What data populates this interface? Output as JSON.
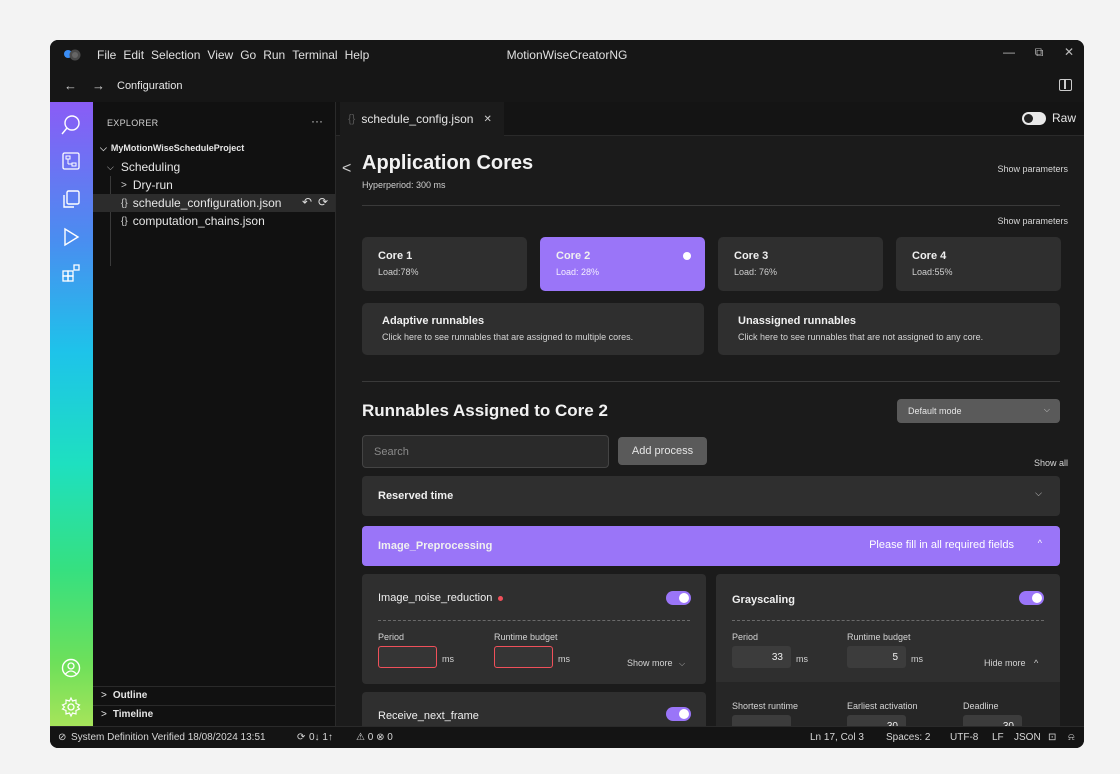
{
  "titlebar": {
    "menu": [
      "File",
      "Edit",
      "Selection",
      "View",
      "Go",
      "Run",
      "Terminal",
      "Help"
    ],
    "title": "MotionWiseCreatorNG",
    "minimize": "—",
    "restore": "⧉",
    "close": "✕"
  },
  "nav": {
    "back": "←",
    "forward": "→",
    "breadcrumb": "Configuration"
  },
  "sidebar": {
    "header": "EXPLORER",
    "more": "···",
    "project": "MyMotionWiseScheduleProject",
    "folder": "Scheduling",
    "subfolder": "Dry-run",
    "files": [
      {
        "icon": "{}",
        "name": "schedule_configuration.json"
      },
      {
        "icon": "{}",
        "name": "computation_chains.json"
      }
    ],
    "outline": "Outline",
    "timeline": "Timeline"
  },
  "editor": {
    "tab": {
      "icon": "{}",
      "label": "schedule_config.json",
      "close": "✕"
    },
    "raw_label": "Raw"
  },
  "page": {
    "title": "Application Cores",
    "hyperperiod": "Hyperperiod: 300 ms",
    "show_parameters": "Show parameters",
    "cores": [
      {
        "name": "Core 1",
        "load": "Load:78%"
      },
      {
        "name": "Core 2",
        "load": "Load: 28%"
      },
      {
        "name": "Core 3",
        "load": "Load: 76%"
      },
      {
        "name": "Core 4",
        "load": "Load:55%"
      }
    ],
    "adaptive": {
      "title": "Adaptive runnables",
      "desc": "Click here to see runnables that are assigned to multiple cores."
    },
    "unassigned": {
      "title": "Unassigned runnables",
      "desc": "Click here to see runnables that are not assigned to any core."
    },
    "section_title": "Runnables Assigned to Core 2",
    "mode": "Default mode",
    "search_placeholder": "Search",
    "add_process": "Add process",
    "show_all": "Show all",
    "reserved_time": "Reserved time",
    "image_preprocessing": "Image_Preprocessing",
    "fill_required": "Please fill in all required fields",
    "runnables": {
      "noise": {
        "name": "Image_noise_reduction",
        "period_label": "Period",
        "budget_label": "Runtime budget",
        "unit": "ms",
        "show_more": "Show more"
      },
      "gray": {
        "name": "Grayscaling",
        "period_label": "Period",
        "period_value": "33",
        "budget_label": "Runtime budget",
        "budget_value": "5",
        "unit": "ms",
        "hide_more": "Hide more",
        "shortest_label": "Shortest runtime",
        "earliest_label": "Earliest activation",
        "earliest_value": "30",
        "deadline_label": "Deadline",
        "deadline_value": "30"
      },
      "receive": {
        "name": "Receive_next_frame"
      }
    }
  },
  "status": {
    "verified": "System Definition Verified 18/08/2024 13:51",
    "sync": "0↓ 1↑",
    "problems": "⚠ 0 ⊗ 0",
    "position": "Ln 17, Col 3",
    "spaces": "Spaces: 2",
    "encoding": "UTF-8",
    "eol": "LF",
    "language": "JSON"
  },
  "colors": {
    "accent": "#9a75f8",
    "error": "#f0505a",
    "background": "#1b1b1b"
  }
}
